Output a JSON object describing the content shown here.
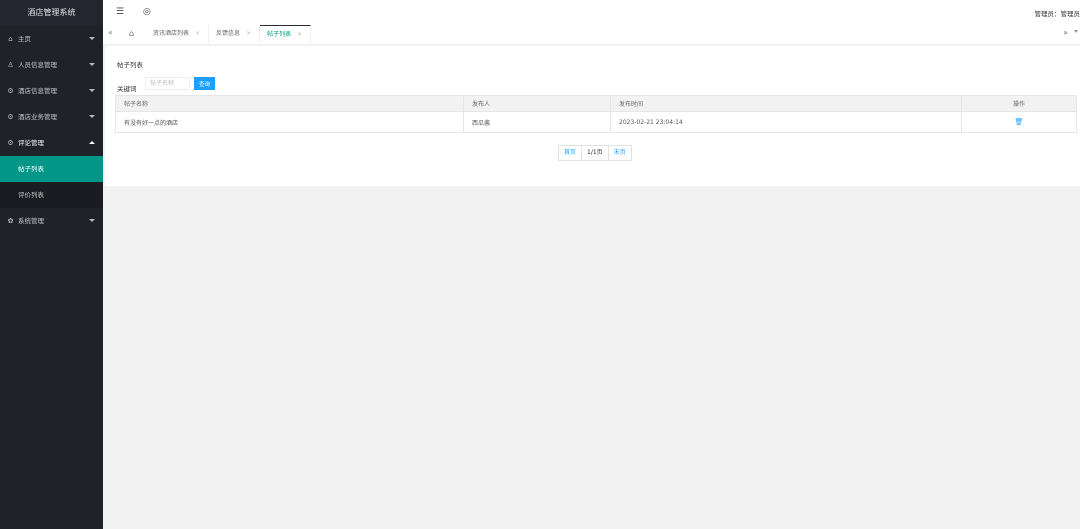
{
  "sidebar": {
    "brand": "酒店管理系统",
    "items": [
      {
        "label": "主页",
        "icon": "home-icon"
      },
      {
        "label": "人员信息管理",
        "icon": "user-icon"
      },
      {
        "label": "酒店信息管理",
        "icon": "gear-icon"
      },
      {
        "label": "酒店业务管理",
        "icon": "gear-icon"
      },
      {
        "label": "评论管理",
        "icon": "gear-icon"
      }
    ],
    "submenu": [
      {
        "label": "帖子列表",
        "active": true
      },
      {
        "label": "评价列表",
        "active": false
      }
    ],
    "system": {
      "label": "系统管理",
      "icon": "settings-icon"
    }
  },
  "header": {
    "admin_label": "管理员：管理员"
  },
  "tabs": [
    {
      "label": "资讯酒店列表",
      "active": false
    },
    {
      "label": "反馈信息",
      "active": false
    },
    {
      "label": "帖子列表",
      "active": true
    }
  ],
  "content": {
    "title": "帖子列表",
    "search_label": "关键词",
    "search_placeholder": "帖子名称",
    "search_button": "查询",
    "columns": [
      "帖子名称",
      "发布人",
      "发布时间",
      "操作"
    ],
    "rows": [
      {
        "name": "有没有好一点的酒店",
        "author": "西瓜酱",
        "time": "2023-02-21 23:04:14"
      }
    ],
    "pager": {
      "first": "首页",
      "info": "1/1页",
      "last": "末页"
    }
  },
  "colors": {
    "accent": "#009688",
    "primary": "#1e9fff",
    "sidebar": "#20222a"
  }
}
